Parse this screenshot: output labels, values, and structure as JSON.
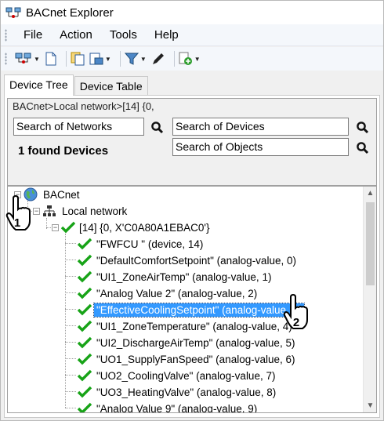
{
  "window": {
    "title": "BACnet Explorer"
  },
  "menu": {
    "items": [
      "File",
      "Action",
      "Tools",
      "Help"
    ]
  },
  "toolbar": {
    "icons": [
      "connect-icon",
      "new-document-icon",
      "copy-icon",
      "export-icon",
      "filter-icon",
      "pen-icon",
      "add-icon"
    ]
  },
  "tabs": [
    {
      "label": "Device Tree",
      "active": true
    },
    {
      "label": "Device Table",
      "active": false
    }
  ],
  "search": {
    "breadcrumb": "BACnet>Local network>[14] {0,",
    "networks_placeholder": "Search of Networks",
    "devices_placeholder": "Search of Devices",
    "objects_placeholder": "Search of Objects",
    "found_text": "1 found Devices"
  },
  "tree": {
    "root": "BACnet",
    "network": "Local network",
    "device": "[14] {0, X'C0A80A1EBAC0'}",
    "objects": [
      "\"FWFCU \" (device, 14)",
      "\"DefaultComfortSetpoint\" (analog-value, 0)",
      "\"UI1_ZoneAirTemp\" (analog-value, 1)",
      "\"Analog Value 2\" (analog-value, 2)",
      "\"EffectiveCoolingSetpoint\" (analog-value, 3)",
      "\"UI1_ZoneTemperature\" (analog-value, 4)",
      "\"UI2_DischargeAirTemp\" (analog-value, 5)",
      "\"UO1_SupplyFanSpeed\" (analog-value, 6)",
      "\"UO2_CoolingValve\" (analog-value, 7)",
      "\"UO3_HeatingValve\" (analog-value, 8)",
      "\"Analog Value 9\" (analog-value, 9)"
    ],
    "selected_index": 4
  },
  "callouts": {
    "one": "1",
    "two": "2"
  },
  "colors": {
    "selection": "#3399ff",
    "check": "#17a317"
  }
}
